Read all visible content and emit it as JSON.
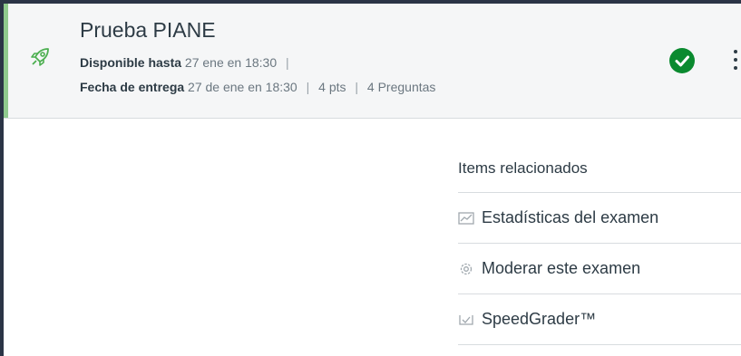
{
  "quiz": {
    "title": "Prueba PIANE",
    "available_label": "Disponible hasta",
    "available_value": "27 ene en 18:30",
    "separator": "|",
    "due_label": "Fecha de entrega",
    "due_value": "27 de ene en 18:30",
    "points": "4 pts",
    "questions": "4 Preguntas",
    "icon": "rocket-icon",
    "status_icon": "published-check-icon",
    "status_color": "#0a8a2f",
    "accent_color": "#8fc98d"
  },
  "related": {
    "heading": "Items relacionados",
    "items": [
      {
        "label": "Estadísticas del examen",
        "icon": "statistics-icon"
      },
      {
        "label": "Moderar este examen",
        "icon": "gear-icon"
      },
      {
        "label": "SpeedGrader™",
        "icon": "speedgrader-icon"
      }
    ]
  }
}
